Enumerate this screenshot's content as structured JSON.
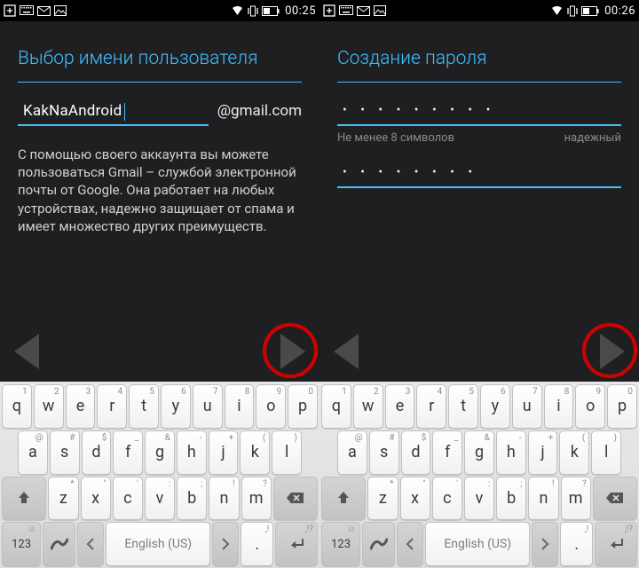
{
  "left": {
    "clock": "00:25",
    "title": "Выбор имени пользователя",
    "username": "KakNaAndroid",
    "domain": "@gmail.com",
    "body": "С помощью своего аккаунта вы можете пользоваться Gmail – службой электронной почты от Google. Она работает на любых устройствах, надежно защищает от спама и имеет множество других преимуществ."
  },
  "right": {
    "clock": "00:26",
    "title": "Создание пароля",
    "password1": "• • • • • • • • •",
    "hint": "Не менее 8 символов",
    "strength": "надежный",
    "password2": "• • • • • • • •"
  },
  "keyboard": {
    "row1": [
      {
        "k": "q",
        "a": "1"
      },
      {
        "k": "w",
        "a": "2"
      },
      {
        "k": "e",
        "a": "3"
      },
      {
        "k": "r",
        "a": "4"
      },
      {
        "k": "t",
        "a": "5"
      },
      {
        "k": "y",
        "a": "6"
      },
      {
        "k": "u",
        "a": "7"
      },
      {
        "k": "i",
        "a": "8"
      },
      {
        "k": "o",
        "a": "9"
      },
      {
        "k": "p",
        "a": "0"
      }
    ],
    "row2": [
      {
        "k": "a",
        "a": "@"
      },
      {
        "k": "s",
        "a": "#"
      },
      {
        "k": "d",
        "a": "$"
      },
      {
        "k": "f",
        "a": "_"
      },
      {
        "k": "g",
        "a": "&"
      },
      {
        "k": "h",
        "a": "-"
      },
      {
        "k": "j",
        "a": "+"
      },
      {
        "k": "k",
        "a": "("
      },
      {
        "k": "l",
        "a": ")"
      }
    ],
    "row3": [
      {
        "k": "z",
        "a": "*"
      },
      {
        "k": "x",
        "a": "\""
      },
      {
        "k": "c",
        "a": "'"
      },
      {
        "k": "v",
        "a": ":"
      },
      {
        "k": "b",
        "a": ";"
      },
      {
        "k": "n",
        "a": "!"
      },
      {
        "k": "m",
        "a": "?"
      }
    ],
    "numKey": "123",
    "lang": "English (US)",
    "enterAlt": ",!?",
    "commaAlt": ",!"
  }
}
